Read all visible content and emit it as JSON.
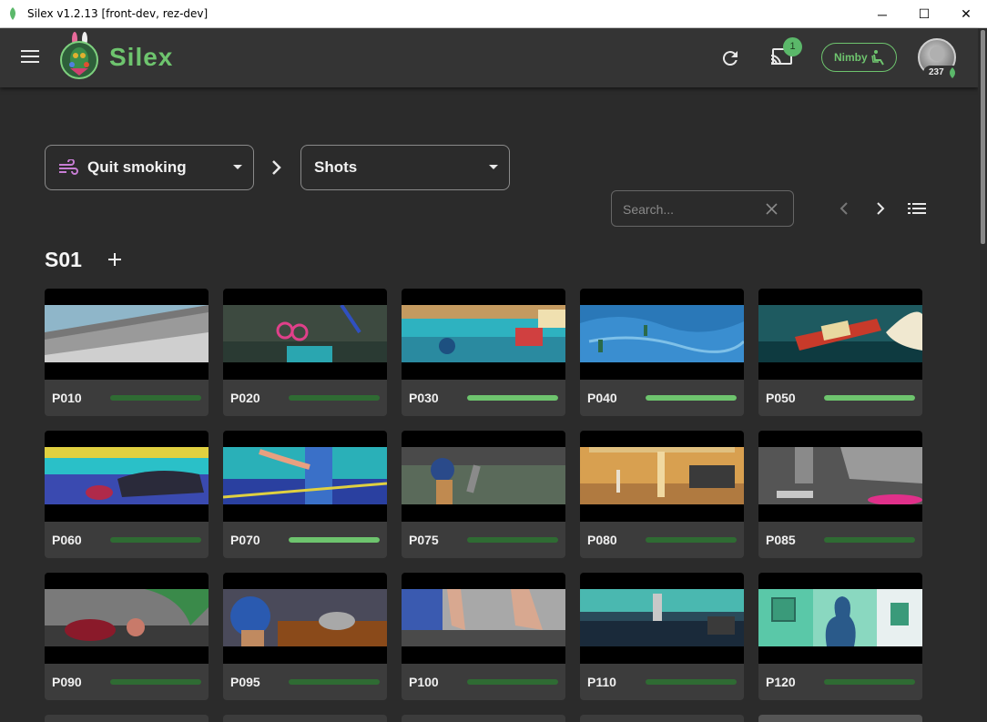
{
  "window": {
    "title": "Silex v1.2.13 [front-dev, rez-dev]",
    "minimize": "─",
    "maximize": "☐",
    "close": "✕"
  },
  "appbar": {
    "brand": "Silex",
    "cast_badge": "1",
    "nimby_label": "Nimby",
    "avatar_count": "237"
  },
  "breadcrumb": {
    "project": "Quit smoking",
    "section": "Shots"
  },
  "search": {
    "placeholder": "Search..."
  },
  "sequence": {
    "title": "S01"
  },
  "colors": {
    "accent": "#6ec46e",
    "progress_track": "#2f6b33",
    "background": "#2b2b2b",
    "card": "#3c3c3c",
    "project_icon": "#c77dd4"
  },
  "shots": [
    {
      "name": "P010",
      "progress": 0.0,
      "thumb": "t1"
    },
    {
      "name": "P020",
      "progress": 0.0,
      "thumb": "t2"
    },
    {
      "name": "P030",
      "progress": 1.0,
      "thumb": "t3"
    },
    {
      "name": "P040",
      "progress": 1.0,
      "thumb": "t4"
    },
    {
      "name": "P050",
      "progress": 1.0,
      "thumb": "t5"
    },
    {
      "name": "P060",
      "progress": 0.0,
      "thumb": "t6"
    },
    {
      "name": "P070",
      "progress": 1.0,
      "thumb": "t7"
    },
    {
      "name": "P075",
      "progress": 0.0,
      "thumb": "t8"
    },
    {
      "name": "P080",
      "progress": 0.0,
      "thumb": "t9"
    },
    {
      "name": "P085",
      "progress": 0.0,
      "thumb": "t10"
    },
    {
      "name": "P090",
      "progress": 0.0,
      "thumb": "t11"
    },
    {
      "name": "P095",
      "progress": 0.0,
      "thumb": "t12"
    },
    {
      "name": "P100",
      "progress": 0.0,
      "thumb": "t13"
    },
    {
      "name": "P110",
      "progress": 0.0,
      "thumb": "t14"
    },
    {
      "name": "P120",
      "progress": 0.0,
      "thumb": "t15"
    }
  ]
}
